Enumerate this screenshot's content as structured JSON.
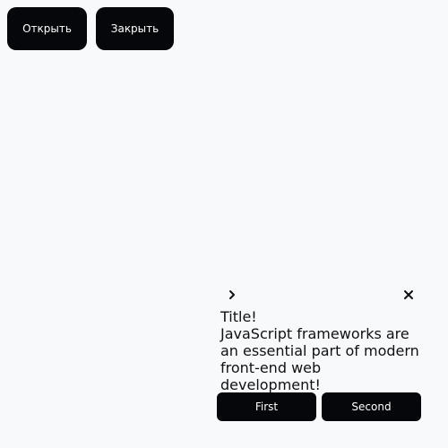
{
  "toolbar": {
    "open_label": "Открыть",
    "close_label": "Закрыть"
  },
  "panel": {
    "title": "Title!",
    "body": "JavaScript frameworks are an essential part of modern front-end web development!",
    "first_label": "First",
    "second_label": "Second",
    "icons": {
      "expand": "chevron-right-icon",
      "close": "close-icon"
    }
  },
  "colors": {
    "background": "#f8f9fb",
    "button": "#05070a",
    "button_text": "#ffffff",
    "text": "#111111"
  }
}
